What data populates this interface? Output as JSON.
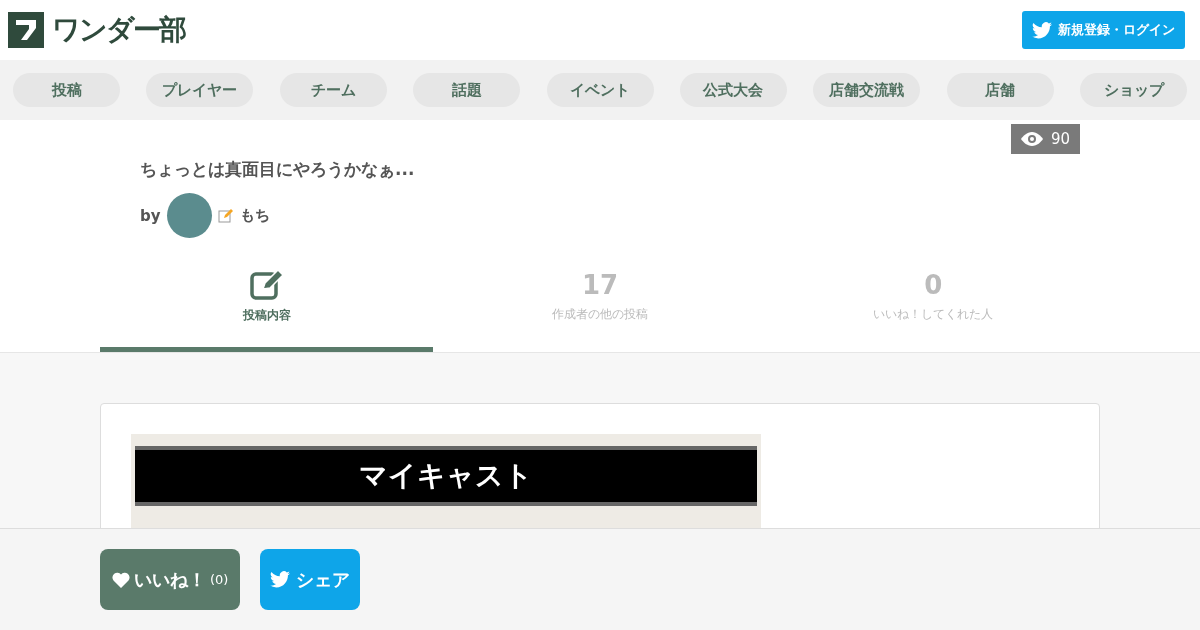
{
  "header": {
    "logo": "ワンダー部",
    "login_button": "新規登録・ログイン"
  },
  "nav": [
    "投稿",
    "プレイヤー",
    "チーム",
    "話題",
    "イベント",
    "公式大会",
    "店舗交流戦",
    "店舗",
    "ショップ"
  ],
  "post": {
    "views": "90",
    "title": "ちょっとは真面目にやろうかなぁ...",
    "by": "by",
    "author": "もち"
  },
  "tabs": [
    {
      "kind": "icon",
      "label": "投稿内容",
      "selected": true
    },
    {
      "kind": "count",
      "count": "17",
      "label": "作成者の他の投稿",
      "selected": false
    },
    {
      "kind": "count",
      "count": "0",
      "label": "いいね！してくれた人",
      "selected": false
    }
  ],
  "banner": {
    "text": "マイキャスト"
  },
  "footer": {
    "like_button": "いいね！",
    "like_count": "(0)",
    "share_button": "シェア"
  }
}
